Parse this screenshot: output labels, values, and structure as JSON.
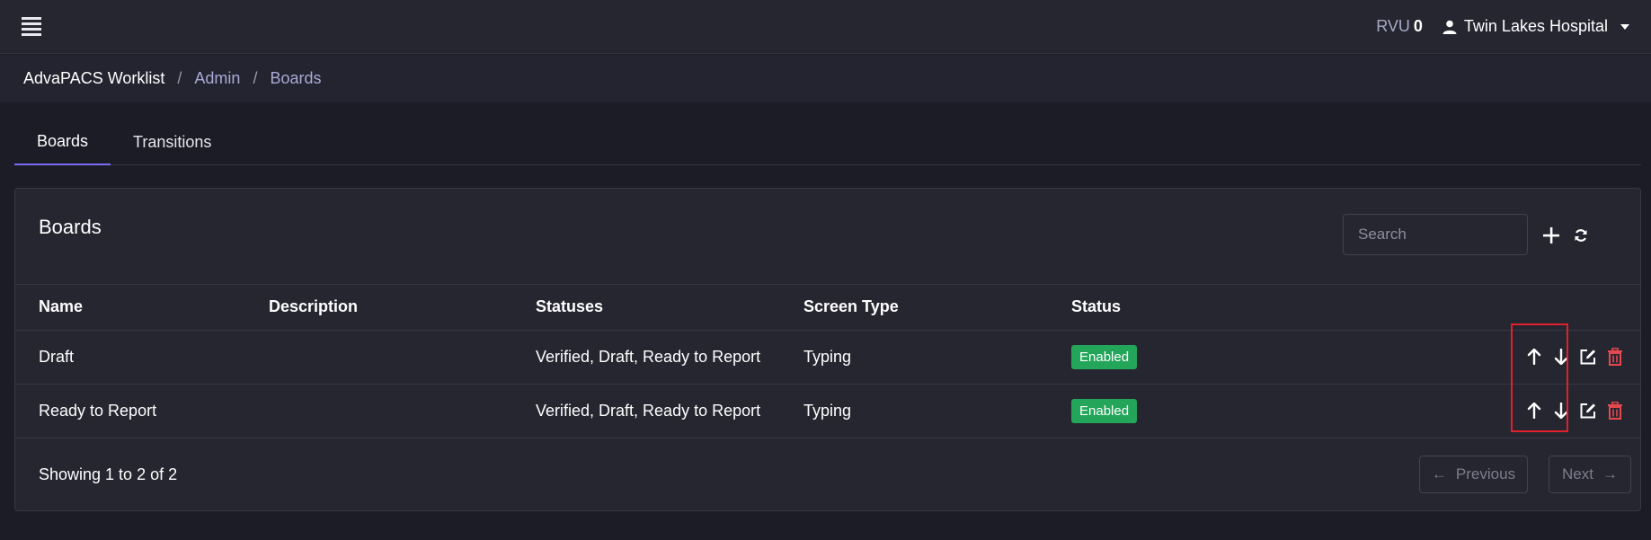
{
  "topbar": {
    "menu_icon": "hamburger-menu-icon",
    "rvu_label": "RVU",
    "rvu_value": "0",
    "user_icon": "user-icon",
    "facility": "Twin Lakes Hospital"
  },
  "breadcrumb": {
    "home": "AdvaPACS Worklist",
    "admin": "Admin",
    "current": "Boards",
    "separator": "/"
  },
  "tabs": [
    {
      "label": "Boards",
      "active": true
    },
    {
      "label": "Transitions",
      "active": false
    }
  ],
  "card": {
    "title": "Boards",
    "search_placeholder": "Search",
    "columns": [
      "Name",
      "Description",
      "Statuses",
      "Screen Type",
      "Status"
    ],
    "rows": [
      {
        "name": "Draft",
        "description": "",
        "statuses": "Verified, Draft, Ready to Report",
        "screen_type": "Typing",
        "status": "Enabled"
      },
      {
        "name": "Ready to Report",
        "description": "",
        "statuses": "Verified, Draft, Ready to Report",
        "screen_type": "Typing",
        "status": "Enabled"
      }
    ],
    "footer": {
      "showing": "Showing 1 to 2 of 2",
      "prev_label": "Previous",
      "prev_arrow": "←",
      "next_label": "Next",
      "next_arrow": "→"
    }
  },
  "colors": {
    "accent": "#7b6cf6",
    "enabled_badge": "#23a55a",
    "delete": "#e5484d",
    "highlight": "#e0202a"
  }
}
